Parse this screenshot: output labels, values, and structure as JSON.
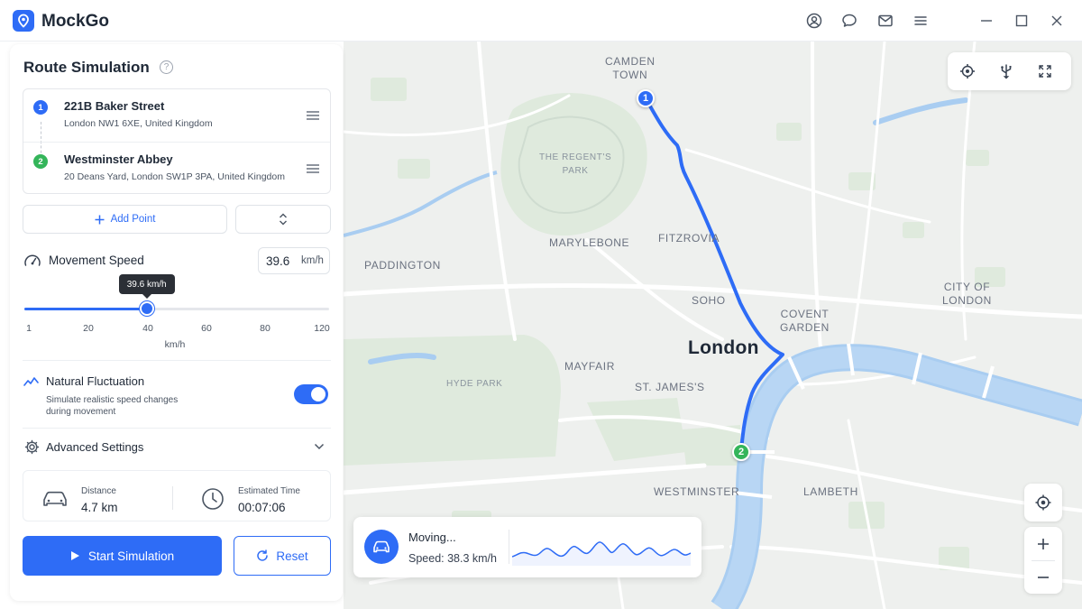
{
  "app": {
    "name": "MockGo"
  },
  "colors": {
    "accent": "#2e6cf6",
    "start_pin": "#2e6cf6",
    "end_pin": "#34b55a",
    "route": "#2e6cf6",
    "water": "#a9cdf1",
    "park": "#dfeadd"
  },
  "titlebar": {
    "icons": [
      "user-circle-icon",
      "chat-bubble-icon",
      "mail-icon",
      "menu-icon"
    ],
    "window_controls": [
      "minimize-icon",
      "maximize-icon",
      "close-icon"
    ]
  },
  "panel": {
    "title": "Route Simulation",
    "help_icon": "?",
    "route": {
      "stops": [
        {
          "num": "1",
          "name": "221B Baker Street",
          "address": "London NW1 6XE, United Kingdom"
        },
        {
          "num": "2",
          "name": "Westminster Abbey",
          "address": "20 Deans Yard, London SW1P 3PA, United Kingdom"
        }
      ]
    },
    "add_point_label": "Add Point",
    "speed": {
      "label": "Movement Speed",
      "value": "39.6",
      "unit": "km/h",
      "tooltip": "39.6 km/h",
      "min": 1,
      "max": 120,
      "current": 39.6,
      "ticks": [
        "1",
        "20",
        "40",
        "60",
        "80",
        "120"
      ],
      "tick_unit": "km/h"
    },
    "fluctuation": {
      "title": "Natural Fluctuation",
      "description": "Simulate realistic speed changes during movement",
      "enabled": true
    },
    "advanced_label": "Advanced Settings",
    "stats": {
      "distance_label": "Distance",
      "distance_value": "4.7 km",
      "time_label": "Estimated Time",
      "time_value": "00:07:06"
    },
    "start_label": "Start Simulation",
    "reset_label": "Reset"
  },
  "map": {
    "labels": {
      "camden": "CAMDEN\nTOWN",
      "regents": "THE REGENT'S\nPARK",
      "marylebone": "MARYLEBONE",
      "fitzrovia": "FITZROVIA",
      "paddington": "PADDINGTON",
      "soho": "SOHO",
      "covent": "COVENT\nGARDEN",
      "city": "CITY OF\nLONDON",
      "london": "London",
      "mayfair": "MAYFAIR",
      "hyde": "HYDE PARK",
      "stjames": "ST. JAMES'S",
      "westminster": "WESTMINSTER",
      "lambeth": "LAMBETH"
    },
    "pins": [
      "1",
      "2"
    ],
    "status": {
      "title": "Moving...",
      "speed": "Speed: 38.3 km/h"
    }
  }
}
